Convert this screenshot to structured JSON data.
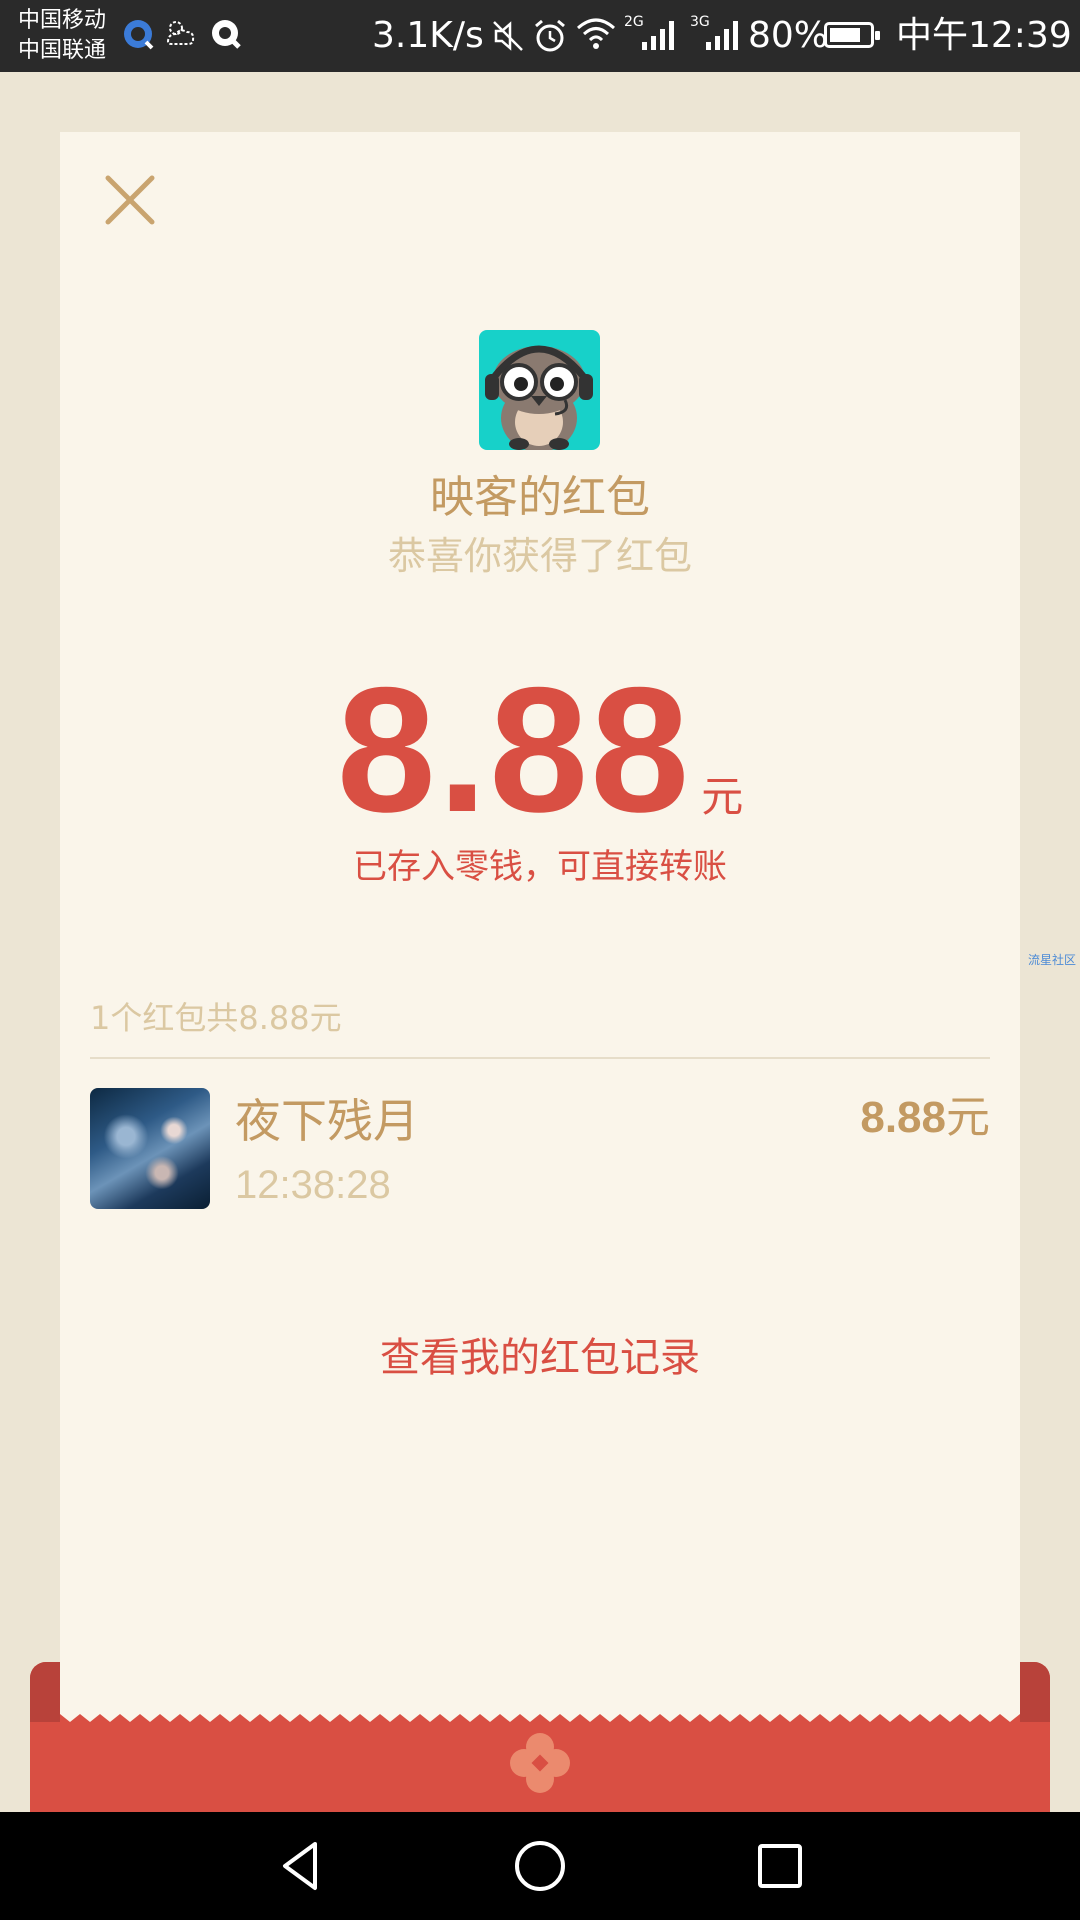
{
  "status_bar": {
    "carrier_1": "中国移动",
    "carrier_2": "中国联通",
    "net_speed": "3.1K/s",
    "net_2g": "2G",
    "net_3g": "3G",
    "battery_pct": "80%",
    "battery_level": 0.8,
    "time": "中午12:39",
    "icons": [
      "browser-icon",
      "weather-icon",
      "app-notification-icon",
      "mute-icon",
      "alarm-icon",
      "wifi-icon",
      "signal-icon",
      "battery-icon"
    ]
  },
  "red_packet": {
    "sender_title": "映客的红包",
    "subtitle": "恭喜你获得了红包",
    "amount": "8.88",
    "unit": "元",
    "note": "已存入零钱，可直接转账",
    "summary": "1个红包共8.88元",
    "records": [
      {
        "name": "夜下残月",
        "time": "12:38:28",
        "amount": "8.88",
        "unit": "元"
      }
    ],
    "record_link": "查看我的红包记录"
  },
  "credit_text": "流星社区",
  "colors": {
    "accent_red": "#d94f43",
    "gold": "#c39a62",
    "light_gold": "#dbc8a2",
    "card_bg": "#faf5ea",
    "page_bg": "#ece5d4",
    "icon_teal": "#17d1c9"
  }
}
